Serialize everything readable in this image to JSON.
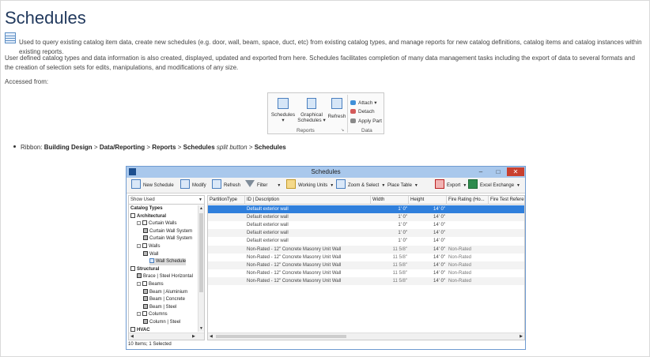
{
  "page": {
    "title": "Schedules",
    "intro": "Used to query existing catalog item data, create new schedules (e.g. door, wall, beam, space, duct, etc) from existing catalog types, and manage reports for new catalog definitions, catalog items and catalog instances within existing reports.",
    "para2": "User defined catalog types and data information is also created, displayed, updated and exported from here. Schedules facilitates completion of many data management tasks including the export of data to several formats and the creation of selection sets for edits, manipulations, and modifications of any size.",
    "accessed": "Accessed from:"
  },
  "ribbon": {
    "schedules": "Schedules",
    "graphical_1": "Graphical",
    "graphical_2": "Schedules",
    "refresh": "Refresh",
    "attach": "Attach",
    "detach": "Detach",
    "apply_part": "Apply Part",
    "group_reports": "Reports",
    "group_data": "Data"
  },
  "bullet": {
    "prefix": "Ribbon: ",
    "p1": "Building Design",
    "sep": " > ",
    "p2": "Data/Reporting",
    "p3": "Reports",
    "p4": "Schedules",
    "split": "split button",
    "p5": "Schedules"
  },
  "window": {
    "title": "Schedules",
    "toolbar": {
      "new_schedule": "New Schedule",
      "modify": "Modify",
      "refresh": "Refresh",
      "filter": "Filter",
      "working_units": "Working Units",
      "zoom_select": "Zoom & Select",
      "place_table": "Place Table",
      "export": "Export",
      "excel_exchange": "Excel Exchange"
    },
    "dropdown": "Show Used",
    "tree": [
      {
        "label": "Catalog Types",
        "level": 0,
        "type": "hdr"
      },
      {
        "label": "Architectural",
        "level": 0,
        "type": "folder-hdr"
      },
      {
        "label": "Curtain Walls",
        "level": 1,
        "type": "folder"
      },
      {
        "label": "Curtain Wall System",
        "level": 2,
        "type": "cube"
      },
      {
        "label": "Curtain Wall System",
        "level": 2,
        "type": "cube"
      },
      {
        "label": "Walls",
        "level": 1,
        "type": "folder"
      },
      {
        "label": "Wall",
        "level": 2,
        "type": "cube"
      },
      {
        "label": "Wall Schedule",
        "level": 3,
        "type": "sch",
        "selected": true
      },
      {
        "label": "Structural",
        "level": 0,
        "type": "folder-hdr"
      },
      {
        "label": "Brace | Steel Horizontal",
        "level": 1,
        "type": "cube"
      },
      {
        "label": "Beams",
        "level": 1,
        "type": "folder"
      },
      {
        "label": "Beam | Aluminium",
        "level": 2,
        "type": "cube"
      },
      {
        "label": "Beam | Concrete",
        "level": 2,
        "type": "cube"
      },
      {
        "label": "Beam | Steel",
        "level": 2,
        "type": "cube"
      },
      {
        "label": "Columns",
        "level": 1,
        "type": "folder"
      },
      {
        "label": "Column | Steel",
        "level": 2,
        "type": "cube"
      },
      {
        "label": "HVAC",
        "level": 0,
        "type": "folder-hdr"
      }
    ],
    "columns": [
      "PartitionType",
      "ID | Description",
      "Width",
      "Height",
      "Fire Rating (Ho...",
      "Fire Test Referen"
    ],
    "rows": [
      [
        "",
        "Default exterior wall",
        "1' 0\"",
        "14' 0\"",
        ""
      ],
      [
        "",
        "Default exterior wall",
        "1' 0\"",
        "14' 0\"",
        ""
      ],
      [
        "",
        "Default exterior wall",
        "1' 0\"",
        "14' 0\"",
        ""
      ],
      [
        "",
        "Default exterior wall",
        "1' 0\"",
        "14' 0\"",
        ""
      ],
      [
        "",
        "Default exterior wall",
        "1' 0\"",
        "14' 0\"",
        ""
      ],
      [
        "",
        "Non-Rated - 12\" Concrete Masonry Unit Wall",
        "11 5/8\"",
        "14' 0\"",
        "Non-Rated"
      ],
      [
        "",
        "Non-Rated - 12\" Concrete Masonry Unit Wall",
        "11 5/8\"",
        "14' 0\"",
        "Non-Rated"
      ],
      [
        "",
        "Non-Rated - 12\" Concrete Masonry Unit Wall",
        "11 5/8\"",
        "14' 0\"",
        "Non-Rated"
      ],
      [
        "",
        "Non-Rated - 12\" Concrete Masonry Unit Wall",
        "11 5/8\"",
        "14' 0\"",
        "Non-Rated"
      ],
      [
        "",
        "Non-Rated - 12\" Concrete Masonry Unit Wall",
        "11 5/8\"",
        "14' 0\"",
        "Non-Rated"
      ]
    ],
    "status": "10 Items; 1 Selected"
  }
}
